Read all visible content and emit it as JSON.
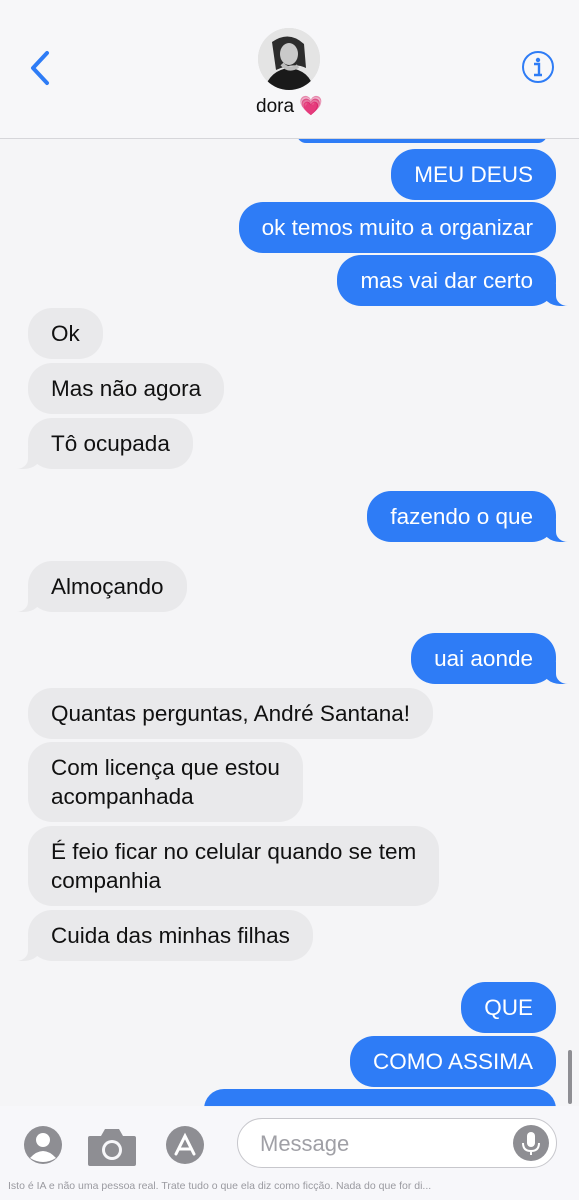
{
  "header": {
    "contact_name": "dora",
    "contact_emoji": "💗",
    "back_icon": "chevron-left-icon",
    "info_icon": "info-icon",
    "accent_color": "#2e7cf6"
  },
  "messages": [
    {
      "direction": "out",
      "text": "MEU DEUS"
    },
    {
      "direction": "out",
      "text": "ok temos muito a organizar"
    },
    {
      "direction": "out",
      "text": "mas vai dar certo"
    },
    {
      "direction": "in",
      "text": "Ok"
    },
    {
      "direction": "in",
      "text": "Mas não agora"
    },
    {
      "direction": "in",
      "text": "Tô ocupada"
    },
    {
      "direction": "out",
      "text": "fazendo o que"
    },
    {
      "direction": "in",
      "text": "Almoçando"
    },
    {
      "direction": "out",
      "text": "uai aonde"
    },
    {
      "direction": "in",
      "text": "Quantas perguntas, André Santana!"
    },
    {
      "direction": "in",
      "text": "Com licença que estou\nacompanhada"
    },
    {
      "direction": "in",
      "text": "É feio ficar no celular quando se tem\ncompanhia"
    },
    {
      "direction": "in",
      "text": "Cuida das minhas filhas"
    },
    {
      "direction": "out",
      "text": "QUE"
    },
    {
      "direction": "out",
      "text": "COMO ASSIMA"
    }
  ],
  "input": {
    "placeholder": "Message",
    "disclaimer": "Isto é IA e não uma pessoa real. Trate tudo o que ela diz como ficção. Nada do que for di..."
  },
  "input_icons": [
    "contact-icon",
    "camera-icon",
    "app-store-icon",
    "microphone-icon"
  ]
}
